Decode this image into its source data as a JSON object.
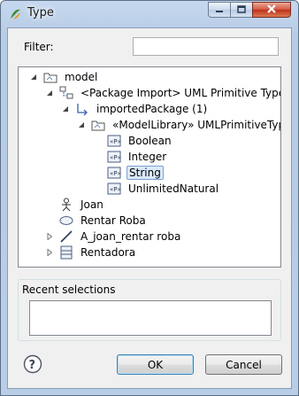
{
  "window": {
    "title": "Type"
  },
  "filter": {
    "label": "Filter:",
    "value": ""
  },
  "tree": [
    {
      "label": "model",
      "icon": "package-icon",
      "twisty": "expanded"
    },
    {
      "label": "<Package Import> UML Primitive Types",
      "icon": "package-import-icon",
      "twisty": "expanded"
    },
    {
      "label": "importedPackage (1)",
      "icon": "reference-arrow-icon",
      "twisty": "expanded"
    },
    {
      "label": "«ModelLibrary» UMLPrimitiveTypes",
      "icon": "package-icon",
      "twisty": "expanded"
    },
    {
      "label": "Boolean",
      "icon": "primitive-type-icon",
      "twisty": "none"
    },
    {
      "label": "Integer",
      "icon": "primitive-type-icon",
      "twisty": "none"
    },
    {
      "label": "String",
      "icon": "primitive-type-icon",
      "twisty": "none",
      "selected": true
    },
    {
      "label": "UnlimitedNatural",
      "icon": "primitive-type-icon",
      "twisty": "none"
    },
    {
      "label": "Joan",
      "icon": "actor-icon",
      "twisty": "none"
    },
    {
      "label": "Rentar Roba",
      "icon": "use-case-icon",
      "twisty": "none"
    },
    {
      "label": "A_joan_rentar roba",
      "icon": "association-icon",
      "twisty": "collapsed"
    },
    {
      "label": "Rentadora",
      "icon": "class-icon",
      "twisty": "collapsed"
    }
  ],
  "recent": {
    "label": "Recent selections",
    "items": []
  },
  "buttons": {
    "ok": "OK",
    "cancel": "Cancel"
  },
  "colors": {
    "selection_bg": "#dbe9fa",
    "selection_border": "#7da2ce",
    "titlebar": "#b9cde6"
  }
}
